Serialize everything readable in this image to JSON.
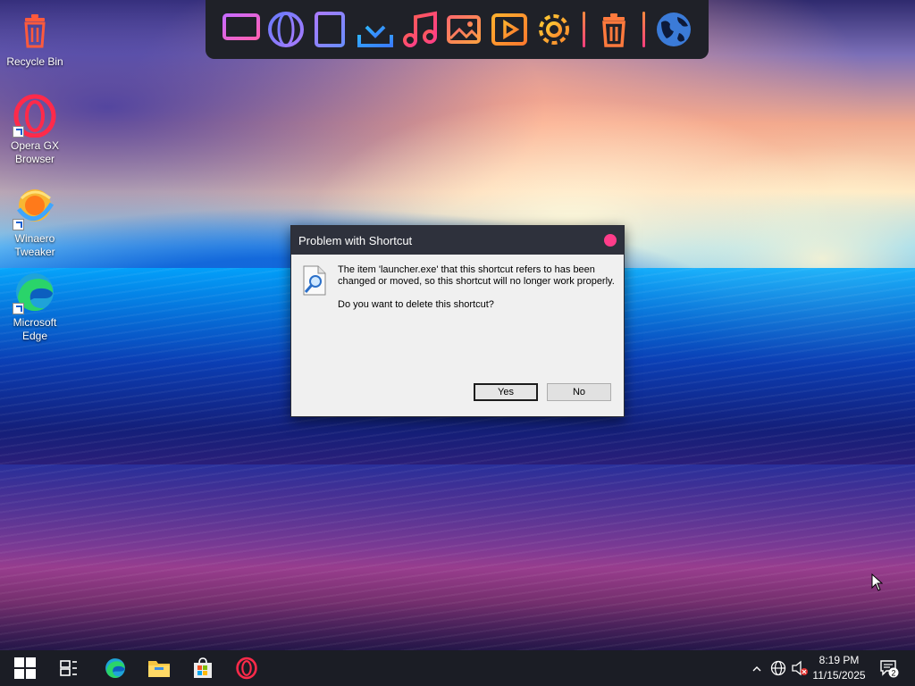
{
  "desktop": {
    "icons": [
      {
        "label": "Recycle Bin",
        "icon": "trash-icon"
      },
      {
        "label": "Opera GX Browser",
        "icon": "opera-gx-icon"
      },
      {
        "label": "Winaero Tweaker",
        "icon": "winaero-tweaker-icon"
      },
      {
        "label": "Microsoft Edge",
        "icon": "edge-icon"
      }
    ]
  },
  "dock": {
    "items": [
      "monitor-icon",
      "globe-icon",
      "document-icon",
      "download-icon",
      "music-icon",
      "image-icon",
      "video-icon",
      "settings-gear-icon",
      "trash-icon",
      "earth-icon"
    ]
  },
  "dialog": {
    "title": "Problem with Shortcut",
    "message": "The item 'launcher.exe' that this shortcut refers to has been changed or moved, so this shortcut will no longer work properly.",
    "question": "Do you want to delete this shortcut?",
    "yes_label": "Yes",
    "no_label": "No",
    "close_color": "#ff3d8a"
  },
  "taskbar": {
    "pinned": [
      "start-windows-icon",
      "task-view-icon",
      "edge-icon",
      "file-explorer-icon",
      "microsoft-store-icon",
      "opera-gx-icon"
    ],
    "tray": [
      "chevron-up-icon",
      "network-globe-icon",
      "volume-muted-icon"
    ],
    "time": "8:19 PM",
    "date": "11/15/2025",
    "notification_count": "2"
  },
  "colors": {
    "taskbar_bg": "#1b1d25",
    "dock_bg": "#1f2128",
    "dialog_titlebar": "#2e313c"
  }
}
